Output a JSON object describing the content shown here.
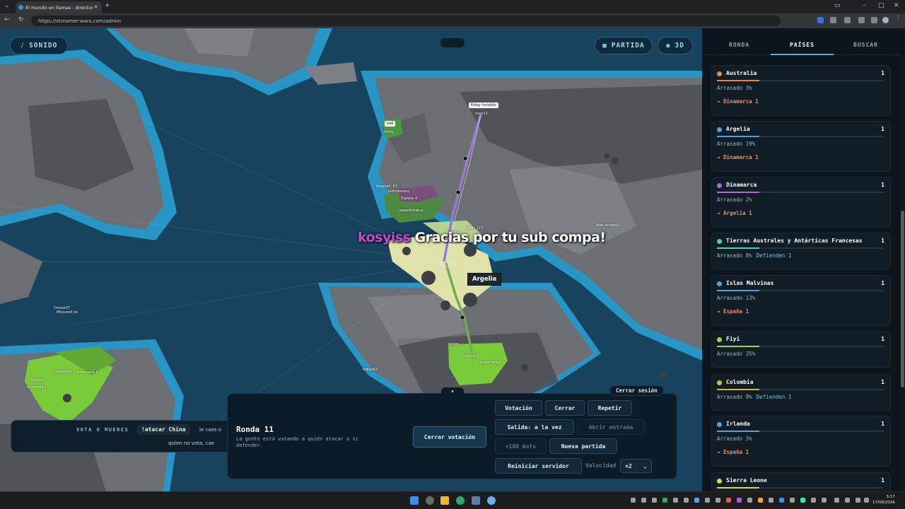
{
  "browser": {
    "tab_title": "El mundo en llamas - director",
    "url": "https://streamer-wars.com/admin",
    "new_tab": "+",
    "close_tab": "×"
  },
  "map": {
    "sound_label": "SONIDO",
    "match_label": "PARTIDA",
    "view_3d_label": "3D",
    "tooltip_country": "Argelia",
    "sub_user": "kosyiss",
    "sub_message": "Gracias por tu sub compa!",
    "cursor_text": "ktm",
    "bubble_top": "Estoy hundido",
    "bubble_left": "xdd",
    "labels": [
      "Astaroth_87",
      "justmourers",
      "España 4",
      "pepolentakus",
      "Argelia 1",
      "illam_117",
      "alex_acuarial",
      "nikiep_",
      "Nigeria 2",
      "pokamenpo",
      "kokoa62",
      "sergiokxyt",
      "Venezuela 1",
      "Nicolay",
      "Colombia 1",
      "Drinpe37",
      "Mhyunoll lix",
      "nitely",
      "svec22"
    ]
  },
  "votebar": {
    "label": "VOTA O MUERES",
    "command": "!atacar China",
    "text1": "le caes o",
    "text2": "quien no vota, cae"
  },
  "admin": {
    "toggle": "▾",
    "round_title": "Ronda 11",
    "round_desc": "La gente está votando a quién atacar o si defender.",
    "close_vote": "Cerrar votación",
    "buttons": {
      "vote": "Votación",
      "close": "Cerrar",
      "repeat": "Repetir",
      "exit_mode": "Salida: a la vez",
      "open_entry": "Abrir entrada",
      "add_bots": "+100 bots",
      "new_match": "Nueva partida",
      "restart_server": "Reiniciar servidor"
    },
    "speed_label": "Velocidad",
    "speed_value": "×2",
    "close_session": "Cerrar sesión"
  },
  "sidebar": {
    "tabs": [
      "RONDA",
      "PAÍSES",
      "BUSCAR"
    ],
    "active_tab": "PAÍSES",
    "countries": [
      {
        "name": "Australia",
        "count": "1",
        "color": "#e88a3c",
        "status": "Arrasado 3%",
        "defend": "",
        "attack": "→ Dinamarca 1",
        "fill": 0.03
      },
      {
        "name": "Argelia",
        "count": "1",
        "color": "#5aa0d8",
        "status": "Arrasado 19%",
        "defend": "",
        "attack": "→ Dinamarca 1",
        "fill": 0.19
      },
      {
        "name": "Dinamarca",
        "count": "1",
        "color": "#b566d6",
        "status": "Arrasado 2%",
        "defend": "",
        "attack": "→ Argelia 1",
        "fill": 0.02
      },
      {
        "name": "Tierras Australes y Antárticas Francesas",
        "count": "1",
        "color": "#4fd1b0",
        "status": "Arrasado 8%",
        "defend": "Defienden 1",
        "attack": "",
        "fill": 0.08
      },
      {
        "name": "Islas Malvinas",
        "count": "1",
        "color": "#5aa0d8",
        "status": "Arrasado 13%",
        "defend": "",
        "attack": "→ España 1",
        "fill": 0.13
      },
      {
        "name": "Fiyi",
        "count": "1",
        "color": "#a8d04a",
        "status": "Arrasado 35%",
        "defend": "",
        "attack": "",
        "fill": 0.35
      },
      {
        "name": "Colombia",
        "count": "1",
        "color": "#e2b24a",
        "status": "Arrasado 9%",
        "defend": "Defienden 1",
        "attack": "",
        "fill": 0.09
      },
      {
        "name": "Irlanda",
        "count": "1",
        "color": "#5aa0d8",
        "status": "Arrasado 3%",
        "defend": "",
        "attack": "→ España 1",
        "fill": 0.03
      },
      {
        "name": "Sierra Leone",
        "count": "1",
        "color": "#d8d84a",
        "status": "",
        "defend": "",
        "attack": "",
        "fill": 0
      }
    ]
  },
  "taskbar": {
    "time": "3:17",
    "date": "17/08/2026"
  }
}
